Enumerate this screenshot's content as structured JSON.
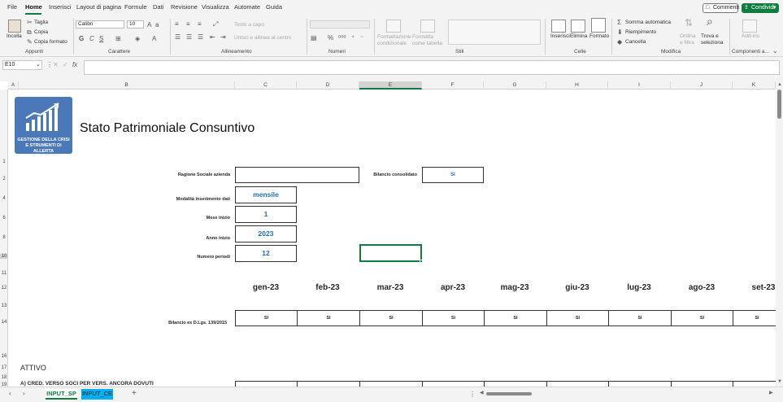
{
  "menu": {
    "items": [
      "File",
      "Home",
      "Inserisci",
      "Layout di pagina",
      "Formule",
      "Dati",
      "Revisione",
      "Visualizza",
      "Automate",
      "Guida"
    ],
    "active": "Home",
    "comments": "Commenti",
    "share": "Condividi"
  },
  "ribbon": {
    "clipboard": {
      "paste": "Incolla",
      "cut": "Taglia",
      "copy": "Copia",
      "format_painter": "Copia formato",
      "label": "Appunti"
    },
    "font": {
      "name": "Calibri",
      "size": "10",
      "label": "Carattere"
    },
    "alignment": {
      "wrap": "Testo a capo",
      "merge": "Unisci e allinea al centro",
      "label": "Allineamento"
    },
    "number": {
      "label": "Numeri"
    },
    "styles": {
      "conditional": "Formattazione condizionale",
      "table": "Formatta come tabella",
      "label": "Stili"
    },
    "cells": {
      "insert": "Inserisci",
      "delete": "Elimina",
      "format": "Formato",
      "label": "Celle"
    },
    "editing": {
      "autosum": "Somma automatica",
      "fill": "Riempimento",
      "clear": "Cancella",
      "sort": "Ordina e filtra",
      "find": "Trova e seleziona",
      "label": "Modifica"
    },
    "addins": {
      "addin": "Add-ins",
      "label": "Componenti a..."
    }
  },
  "formula_bar": {
    "name_box": "E10",
    "formula": ""
  },
  "columns": [
    "A",
    "B",
    "C",
    "D",
    "E",
    "F",
    "G",
    "H",
    "I",
    "J",
    "K"
  ],
  "selected_column": "E",
  "rows": [
    "1",
    "2",
    "4",
    "6",
    "8",
    "10",
    "11",
    "12",
    "13",
    "14",
    "16",
    "17",
    "18",
    "19"
  ],
  "selected_row": "10",
  "sheet": {
    "logo_text": "GESTIONE DELLA CRISI E STRUMENTI DI ALLERTA",
    "title": "Stato Patrimoniale Consuntivo",
    "ragione_label": "Ragione Sociale azienda",
    "ragione_value": "",
    "bilancio_consolidato_label": "Bilancio consolidato",
    "bilancio_consolidato_value": "SI",
    "modalita_label": "Modalità inserimento dati",
    "modalita_value": "mensile",
    "mese_label": "Mese inizio",
    "mese_value": "1",
    "anno_label": "Anno inizio",
    "anno_value": "2023",
    "periodi_label": "Numero periodi",
    "periodi_value": "12",
    "months": [
      "gen-23",
      "feb-23",
      "mar-23",
      "apr-23",
      "mag-23",
      "giu-23",
      "lug-23",
      "ago-23",
      "set-23"
    ],
    "bilancio_ex_label": "Bilancio ex D.Lgs. 139/2015",
    "bilancio_ex_values": [
      "SI",
      "SI",
      "SI",
      "SI",
      "SI",
      "SI",
      "SI",
      "SI",
      "SI"
    ],
    "attivo_label": "ATTIVO",
    "crediti_label": "A) CRED. VERSO SOCI PER VERS. ANCORA DOVUTI"
  },
  "tabs": [
    {
      "name": "INPUT_SP",
      "active": true
    },
    {
      "name": "INPUT_CE",
      "active": false
    }
  ],
  "colors": {
    "accent": "#107c41",
    "logo_bg": "#4a78b8",
    "value_blue": "#1f6fb2",
    "tab_ce": "#00b0f0"
  }
}
